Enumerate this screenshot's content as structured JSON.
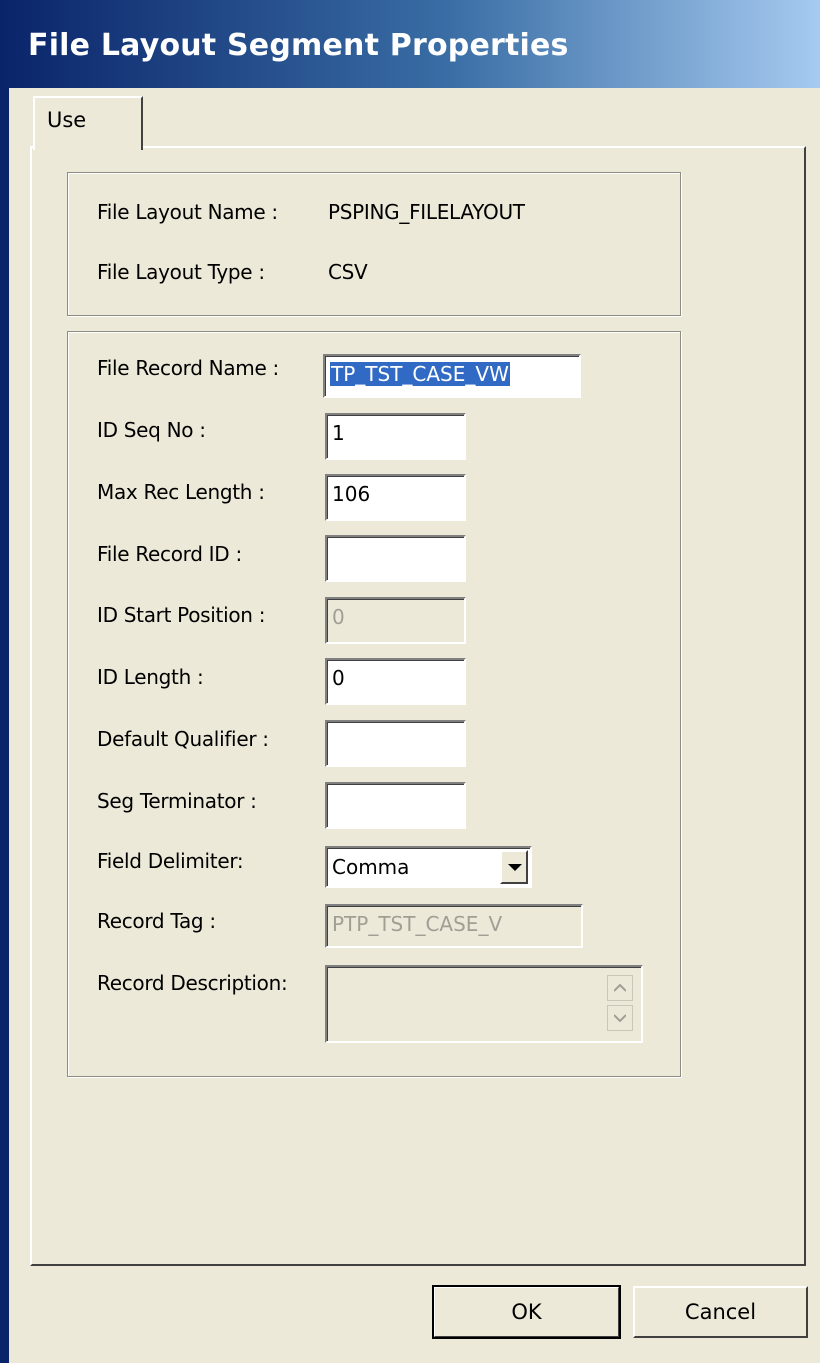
{
  "window": {
    "title": "File Layout Segment Properties"
  },
  "tabs": [
    {
      "label": "Use",
      "active": true
    }
  ],
  "layout_info": {
    "name_label": "File Layout Name :",
    "name_value": "PSPING_FILELAYOUT",
    "type_label": "File Layout Type :",
    "type_value": "CSV"
  },
  "form": {
    "file_record_name": {
      "label": "File Record Name :",
      "value": "TP_TST_CASE_VW"
    },
    "id_seq_no": {
      "label": "ID Seq No :",
      "value": "1"
    },
    "max_rec_length": {
      "label": "Max Rec Length :",
      "value": "106"
    },
    "file_record_id": {
      "label": "File Record ID :",
      "value": ""
    },
    "id_start_position": {
      "label": "ID Start Position :",
      "value": "0"
    },
    "id_length": {
      "label": "ID Length :",
      "value": "0"
    },
    "default_qualifier": {
      "label": "Default Qualifier :",
      "value": ""
    },
    "seg_terminator": {
      "label": "Seg Terminator :",
      "value": ""
    },
    "field_delimiter": {
      "label": "Field Delimiter:",
      "value": "Comma"
    },
    "record_tag": {
      "label": "Record Tag :",
      "value": "PTP_TST_CASE_V"
    },
    "record_description": {
      "label": "Record Description:",
      "value": ""
    }
  },
  "buttons": {
    "ok": "OK",
    "cancel": "Cancel"
  },
  "icons": {
    "dropdown": "chevron-down-icon",
    "scroll_up": "scroll-up-icon",
    "scroll_down": "scroll-down-icon"
  },
  "colors": {
    "title_bar": "#0a246a",
    "dialog_bg": "#ece9d8",
    "selection": "#316ac5"
  }
}
